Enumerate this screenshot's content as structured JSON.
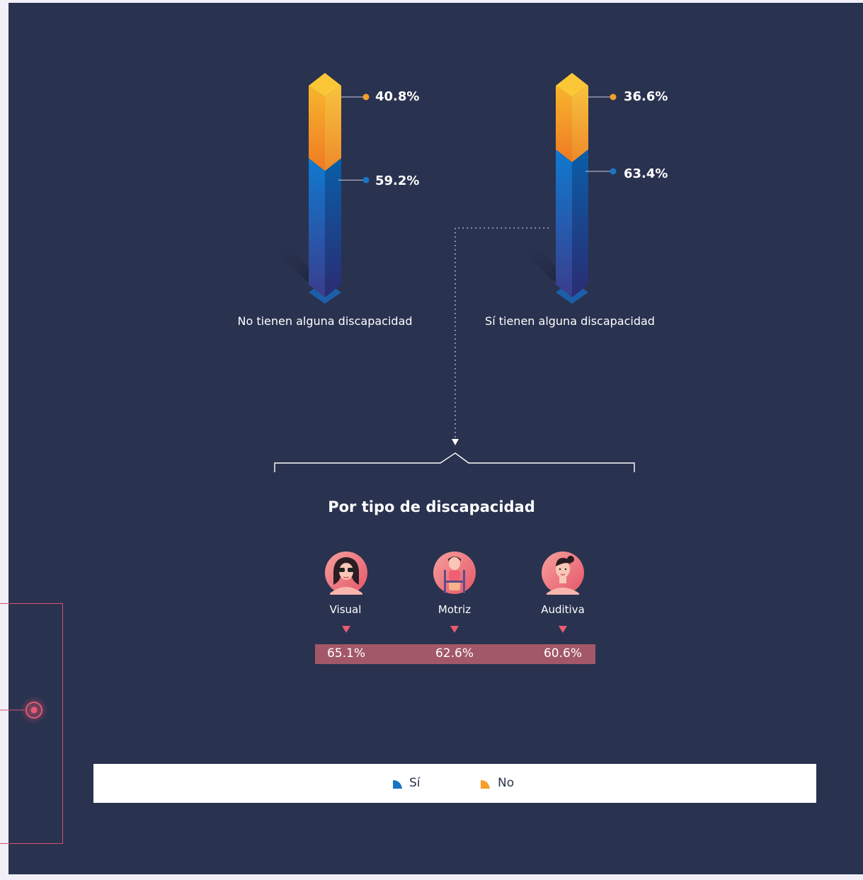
{
  "chart_data": {
    "type": "bar",
    "stacked": true,
    "categories": [
      "No tienen alguna discapacidad",
      "Sí tienen alguna discapacidad"
    ],
    "series": [
      {
        "name": "Sí",
        "values": [
          59.2,
          63.4
        ],
        "labels": [
          "59.2%",
          "63.4%"
        ],
        "color": "#1a74c4"
      },
      {
        "name": "No",
        "values": [
          40.8,
          36.6
        ],
        "labels": [
          "40.8%",
          "36.6%"
        ],
        "color": "#f3a02a"
      }
    ],
    "ylim": [
      0,
      100
    ]
  },
  "disability_breakdown": {
    "title": "Por tipo de discapacidad",
    "types": [
      {
        "label": "Visual",
        "value": 65.1,
        "value_label": "65.1%",
        "icon": "woman-sunglasses-icon"
      },
      {
        "label": "Motriz",
        "value": 62.6,
        "value_label": "62.6%",
        "icon": "woman-wheelchair-icon"
      },
      {
        "label": "Auditiva",
        "value": 60.6,
        "value_label": "60.6%",
        "icon": "woman-hearing-icon"
      }
    ]
  },
  "legend": [
    {
      "label": "Sí",
      "color": "#1a74c4"
    },
    {
      "label": "No",
      "color": "#f3a02a"
    }
  ],
  "colors": {
    "background": "#29324f",
    "accent_pink": "#e85a72",
    "strip": "#a25868"
  }
}
